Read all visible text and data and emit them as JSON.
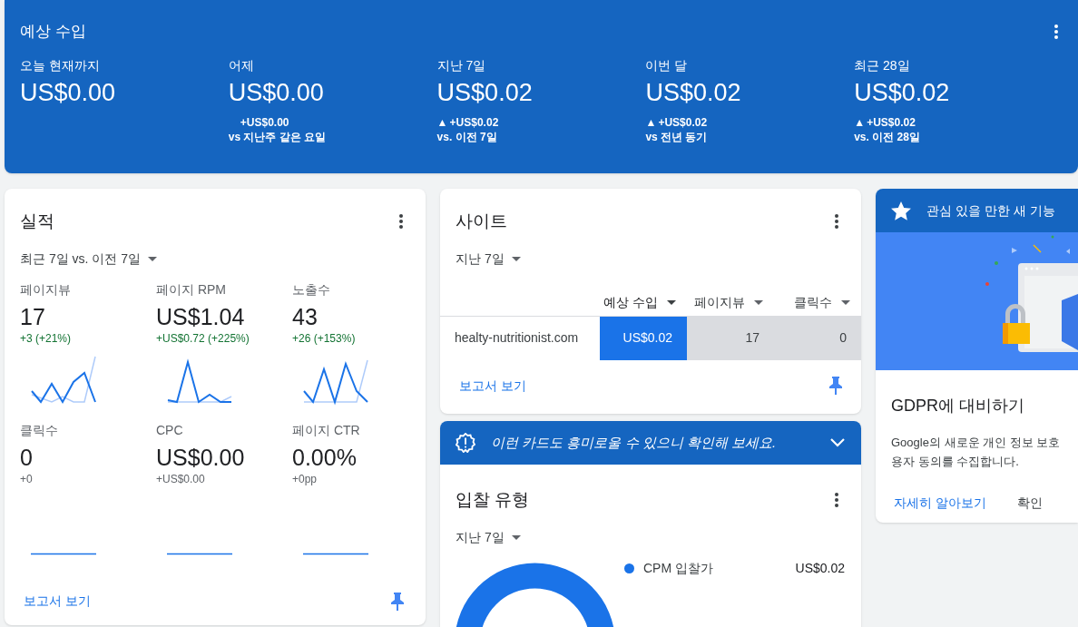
{
  "earnings": {
    "title": "예상 수입",
    "periods": [
      {
        "label": "오늘 현재까지",
        "value": "US$0.00"
      },
      {
        "label": "어제",
        "value": "US$0.00",
        "change": "+US$0.00",
        "compare": "vs 지난주 같은 요일"
      },
      {
        "label": "지난 7일",
        "value": "US$0.02",
        "arrow": "▲",
        "change": "+US$0.02",
        "compare": "vs. 이전 7일"
      },
      {
        "label": "이번 달",
        "value": "US$0.02",
        "arrow": "▲",
        "change": "+US$0.02",
        "compare": "vs 전년 동기"
      },
      {
        "label": "최근 28일",
        "value": "US$0.02",
        "arrow": "▲",
        "change": "+US$0.02",
        "compare": "vs. 이전 28일"
      }
    ]
  },
  "performance": {
    "title": "실적",
    "range": "최근 7일 vs. 이전 7일",
    "metrics": [
      {
        "label": "페이지뷰",
        "value": "17",
        "change": "+3 (+21%)",
        "positive": true
      },
      {
        "label": "페이지 RPM",
        "value": "US$1.04",
        "change": "+US$0.72 (+225%)",
        "positive": true
      },
      {
        "label": "노출수",
        "value": "43",
        "change": "+26 (+153%)",
        "positive": true
      },
      {
        "label": "클릭수",
        "value": "0",
        "change": "+0",
        "positive": false
      },
      {
        "label": "CPC",
        "value": "US$0.00",
        "change": "+US$0.00",
        "positive": false
      },
      {
        "label": "페이지 CTR",
        "value": "0.00%",
        "change": "+0pp",
        "positive": false
      }
    ],
    "link": "보고서 보기"
  },
  "sites": {
    "title": "사이트",
    "range": "지난 7일",
    "columns": [
      {
        "label": "예상 수입",
        "selected": true
      },
      {
        "label": "페이지뷰",
        "selected": false
      },
      {
        "label": "클릭수",
        "selected": false
      }
    ],
    "rows": [
      {
        "site": "healty-nutritionist.com",
        "cells": [
          "US$0.02",
          "17",
          "0"
        ]
      }
    ],
    "link": "보고서 보기"
  },
  "suggestion_banner": {
    "text": "이런 카드도 흥미로울 수 있으니 확인해 보세요."
  },
  "bid_types": {
    "title": "입찰 유형",
    "range": "지난 7일",
    "legend": [
      {
        "label": "CPM 입찰가",
        "value": "US$0.02",
        "color": "#1a73e8"
      }
    ]
  },
  "new_feature": {
    "header": "관심 있을 만한 새 기능",
    "title": "GDPR에 대비하기",
    "body_lines": [
      "Google의 새로운 개인 정보 보호",
      "용자 동의를 수집합니다."
    ],
    "actions": [
      "자세히 알아보기",
      "확인"
    ]
  }
}
